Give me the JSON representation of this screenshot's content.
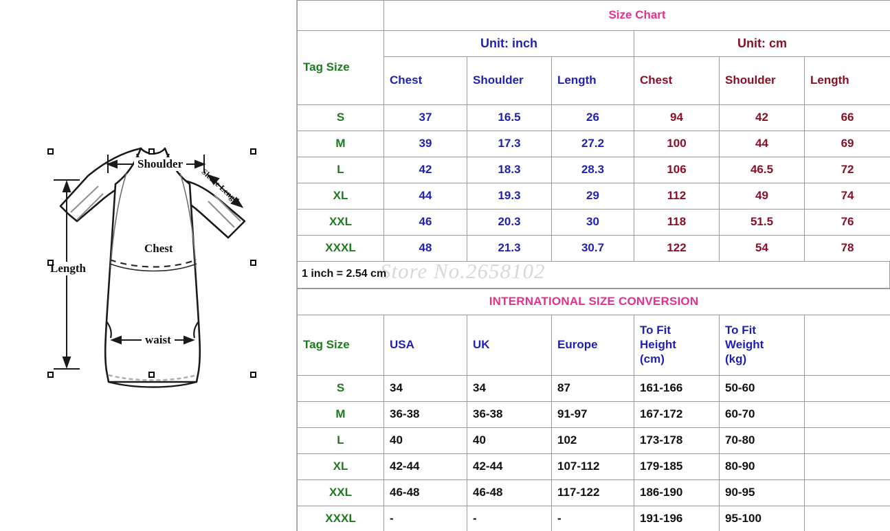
{
  "diagram": {
    "labels": {
      "shoulder": "Shoulder",
      "sleeve_length": "Sleeve Length",
      "chest": "Chest",
      "length": "Length",
      "waist": "waist"
    }
  },
  "size_chart": {
    "title": "Size Chart",
    "tag_size_header": "Tag Size",
    "unit_groups": [
      {
        "label": "Unit: inch",
        "color": "#1f1fb4",
        "columns": [
          "Chest",
          "Shoulder",
          "Length"
        ]
      },
      {
        "label": "Unit: cm",
        "color": "#8a0f26",
        "columns": [
          "Chest",
          "Shoulder",
          "Length"
        ]
      }
    ],
    "rows": [
      {
        "tag": "S",
        "inch": [
          "37",
          "16.5",
          "26"
        ],
        "cm": [
          "94",
          "42",
          "66"
        ]
      },
      {
        "tag": "M",
        "inch": [
          "39",
          "17.3",
          "27.2"
        ],
        "cm": [
          "100",
          "44",
          "69"
        ]
      },
      {
        "tag": "L",
        "inch": [
          "42",
          "18.3",
          "28.3"
        ],
        "cm": [
          "106",
          "46.5",
          "72"
        ]
      },
      {
        "tag": "XL",
        "inch": [
          "44",
          "19.3",
          "29"
        ],
        "cm": [
          "112",
          "49",
          "74"
        ]
      },
      {
        "tag": "XXL",
        "inch": [
          "46",
          "20.3",
          "30"
        ],
        "cm": [
          "118",
          "51.5",
          "76"
        ]
      },
      {
        "tag": "XXXL",
        "inch": [
          "48",
          "21.3",
          "30.7"
        ],
        "cm": [
          "122",
          "54",
          "78"
        ]
      }
    ],
    "note": "1 inch = 2.54 cm",
    "watermark": "Store No.2658102"
  },
  "international": {
    "title": "INTERNATIONAL SIZE CONVERSION",
    "headers": [
      "Tag Size",
      "USA",
      "UK",
      "Europe",
      "To Fit Height (cm)",
      "To Fit Weight (kg)",
      ""
    ],
    "headers_multiline": {
      "height": [
        "To Fit",
        "Height",
        "(cm)"
      ],
      "weight": [
        "To Fit",
        "Weight",
        "(kg)"
      ]
    },
    "rows": [
      {
        "tag": "S",
        "usa": "34",
        "uk": "34",
        "europe": "87",
        "height": "161-166",
        "weight": "50-60",
        "extra": ""
      },
      {
        "tag": "M",
        "usa": "36-38",
        "uk": "36-38",
        "europe": "91-97",
        "height": "167-172",
        "weight": "60-70",
        "extra": ""
      },
      {
        "tag": "L",
        "usa": "40",
        "uk": "40",
        "europe": "102",
        "height": "173-178",
        "weight": "70-80",
        "extra": ""
      },
      {
        "tag": "XL",
        "usa": "42-44",
        "uk": "42-44",
        "europe": "107-112",
        "height": "179-185",
        "weight": "80-90",
        "extra": ""
      },
      {
        "tag": "XXL",
        "usa": "46-48",
        "uk": "46-48",
        "europe": "117-122",
        "height": "186-190",
        "weight": "90-95",
        "extra": ""
      },
      {
        "tag": "XXXL",
        "usa": "-",
        "uk": "-",
        "europe": "-",
        "height": "191-196",
        "weight": "95-100",
        "extra": ""
      }
    ]
  },
  "colors": {
    "title_pink": "#e3318c",
    "tag_green": "#1d7a1d",
    "inch_blue": "#1f1fb4",
    "cm_maroon": "#8a0f26",
    "value_black": "#111111",
    "grid_line": "#9a9a9a"
  }
}
